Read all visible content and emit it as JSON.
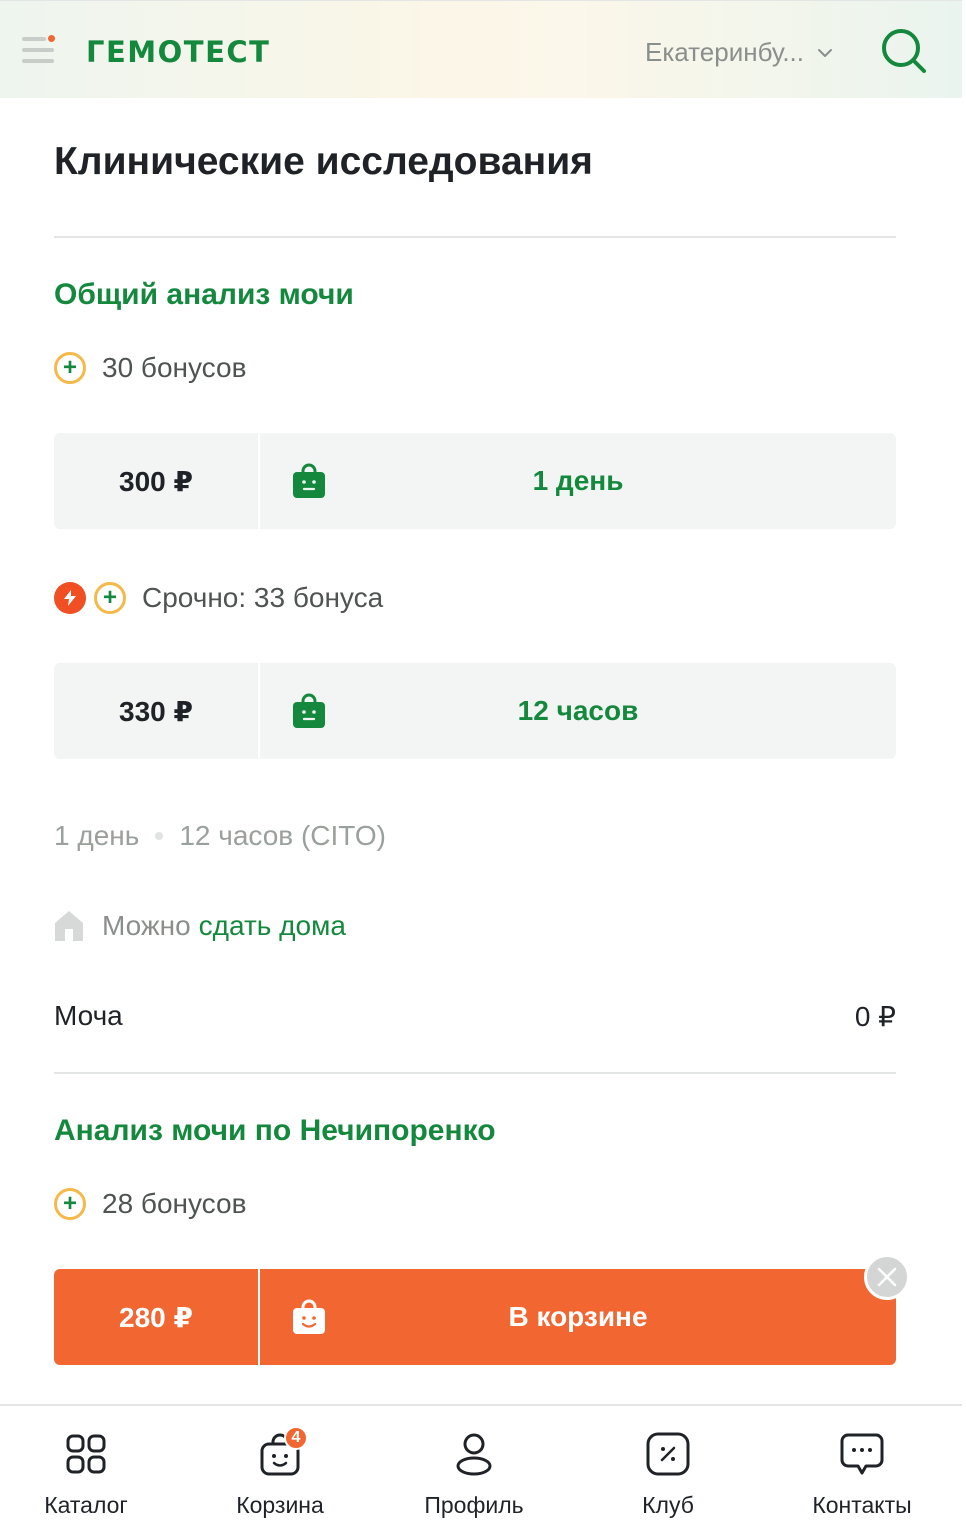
{
  "header": {
    "brand": "ГЕМОТЕСТ",
    "city": "Екатеринбу...",
    "icons": [
      "menu-icon",
      "chevron-down-icon",
      "search-icon"
    ]
  },
  "page": {
    "title": "Клинические исследования"
  },
  "analyses": [
    {
      "title": "Общий анализ мочи",
      "bonus": "30 бонусов",
      "regular": {
        "price": "300 ₽",
        "term": "1 день"
      },
      "urgent_bonus": "Срочно: 33 бонуса",
      "urgent": {
        "price": "330 ₽",
        "term": "12 часов"
      },
      "terms": [
        "1 день",
        "12 часов (CITO)"
      ],
      "home_prefix": "Можно",
      "home_link": "сдать дома",
      "biomaterial": "Моча",
      "biomaterial_price": "0 ₽"
    },
    {
      "title": "Анализ мочи по Нечипоренко",
      "bonus": "28 бонусов",
      "regular": {
        "price": "280 ₽",
        "action": "В корзине"
      }
    }
  ],
  "bottom_nav": {
    "catalog": "Каталог",
    "cart": "Корзина",
    "cart_count": "4",
    "profile": "Профиль",
    "club": "Клуб",
    "contacts": "Контакты"
  },
  "colors": {
    "brand_green": "#14893e",
    "accent_orange": "#f26632",
    "bonus_ring": "#f5b94a"
  }
}
